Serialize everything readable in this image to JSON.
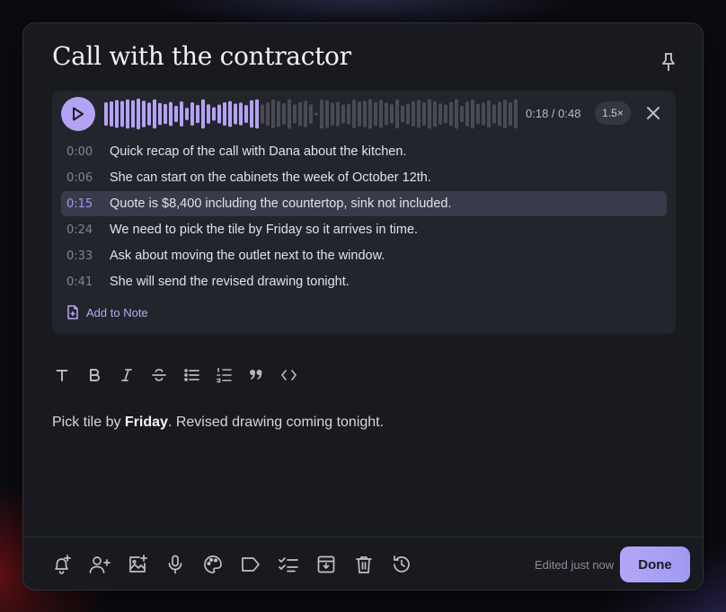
{
  "note": {
    "title": "Call with the contractor",
    "body_parts": [
      "Pick tile by ",
      "Friday",
      ". Revised drawing coming tonight."
    ]
  },
  "audio": {
    "time_readout": "0:18 / 0:48",
    "progress_fraction": 0.375,
    "speed": "1.5×",
    "transcript": [
      {
        "time": "0:00",
        "text": "Quick recap of the call with Dana about the kitchen."
      },
      {
        "time": "0:06",
        "text": "She can start on the cabinets the week of October 12th."
      },
      {
        "time": "0:15",
        "text": "Quote is $8,400 including the countertop, sink not included."
      },
      {
        "time": "0:24",
        "text": "We need to pick the tile by Friday so it arrives in time."
      },
      {
        "time": "0:33",
        "text": "Ask about moving the outlet next to the window."
      },
      {
        "time": "0:41",
        "text": "She will send the revised drawing tonight."
      }
    ],
    "active_line": 2,
    "add_to_note_label": "Add to Note"
  },
  "toolbar": {
    "icons": [
      "text-style-icon",
      "bold-icon",
      "italic-icon",
      "strikethrough-icon",
      "bullet-list-icon",
      "numbered-list-icon",
      "quote-icon",
      "code-icon"
    ]
  },
  "footer": {
    "icons": [
      "reminder-icon",
      "collaborator-icon",
      "add-image-icon",
      "microphone-icon",
      "palette-icon",
      "label-icon",
      "checklist-icon",
      "archive-icon",
      "trash-icon",
      "history-icon"
    ],
    "edited_label": "Edited just now",
    "done_label": "Done"
  },
  "colors": {
    "accent": "#b4a2f5",
    "played": "#b4a2f5",
    "unplayed": "#4a4b52",
    "card_bg": "#23252c",
    "modal_bg": "#191a20"
  }
}
